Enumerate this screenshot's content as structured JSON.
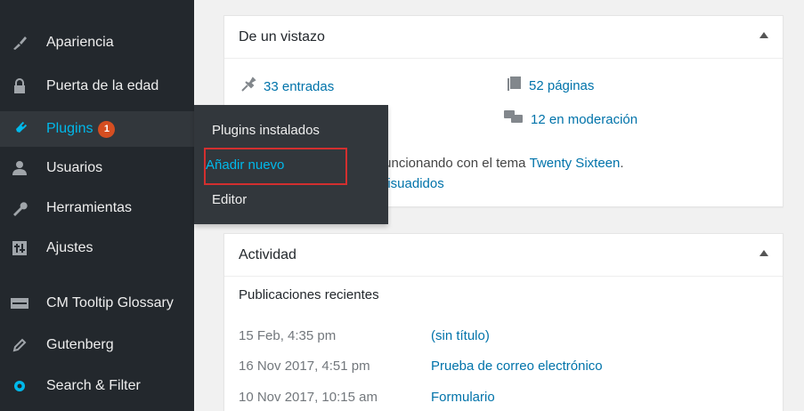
{
  "sidebar": {
    "items": [
      {
        "label": "Apariencia",
        "icon": "paintbrush-icon"
      },
      {
        "label": "Puerta de la edad",
        "icon": "lock-icon"
      },
      {
        "label": "Plugins",
        "icon": "plug-icon",
        "badge": "1"
      },
      {
        "label": "Usuarios",
        "icon": "users-icon"
      },
      {
        "label": "Herramientas",
        "icon": "wrench-icon"
      },
      {
        "label": "Ajustes",
        "icon": "settings-icon"
      },
      {
        "label": "CM Tooltip Glossary",
        "icon": "glossary-icon"
      },
      {
        "label": "Gutenberg",
        "icon": "pencil-icon"
      },
      {
        "label": "Search & Filter",
        "icon": "search-filter-icon"
      }
    ]
  },
  "flyout": {
    "items": [
      "Plugins instalados",
      "Añadir nuevo",
      "Editor"
    ]
  },
  "glance": {
    "title": "De un vistazo",
    "entries": "33 entradas",
    "pages": "52 páginas",
    "moderation": "12 en moderación",
    "theme_text": "funcionando con el tema ",
    "theme_link": "Twenty Sixteen",
    "theme_end": ".",
    "discouraged": "disuadidos"
  },
  "activity": {
    "title": "Actividad",
    "section": "Publicaciones recientes",
    "rows": [
      {
        "date": "15 Feb, 4:35 pm",
        "title": "(sin título)"
      },
      {
        "date": "16 Nov 2017, 4:51 pm",
        "title": "Prueba de correo electrónico"
      },
      {
        "date": "10 Nov 2017, 10:15 am",
        "title": "Formulario"
      }
    ]
  },
  "colors": {
    "sidebar": "#23282d",
    "accent": "#00b9eb",
    "link": "#0073aa",
    "badge": "#d54e21",
    "highlight": "#d32f2f"
  }
}
